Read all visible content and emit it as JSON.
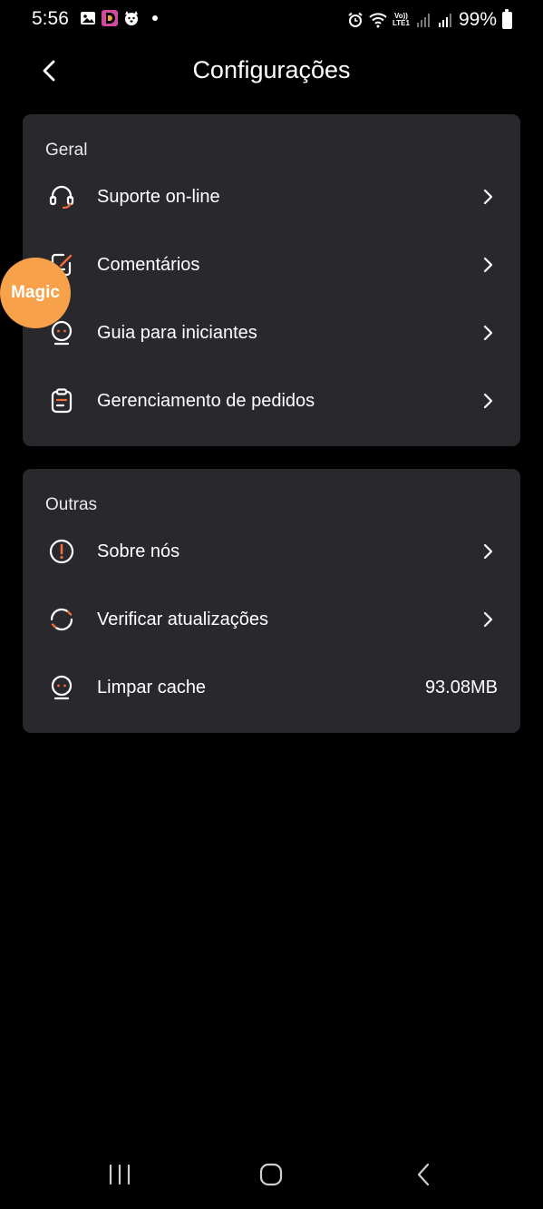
{
  "status_bar": {
    "time": "5:56",
    "battery": "99%",
    "volte_top": "Vo))",
    "volte_bottom": "LTE1",
    "icons": [
      "gallery-icon",
      "app-d-icon",
      "dog-icon",
      "alarm-icon",
      "wifi-icon",
      "volte-icon",
      "signal-icon",
      "signal-icon",
      "battery-icon"
    ]
  },
  "header": {
    "title": "Configurações",
    "back_icon": "chevron-left-icon"
  },
  "sections": {
    "general": {
      "title": "Geral",
      "items": [
        {
          "label": "Suporte on-line",
          "icon": "headset-icon"
        },
        {
          "label": "Comentários",
          "icon": "feedback-edit-icon"
        },
        {
          "label": "Guia para iniciantes",
          "icon": "beginner-guide-icon"
        },
        {
          "label": "Gerenciamento de pedidos",
          "icon": "clipboard-icon"
        }
      ]
    },
    "other": {
      "title": "Outras",
      "items": [
        {
          "label": "Sobre nós",
          "icon": "info-alert-icon"
        },
        {
          "label": "Verificar atualizações",
          "icon": "refresh-icon"
        },
        {
          "label": "Limpar cache",
          "icon": "clean-cache-icon",
          "value": "93.08MB"
        }
      ]
    }
  },
  "magic_bubble": {
    "label": "Magic"
  },
  "colors": {
    "background": "#000000",
    "card": "#29282c",
    "accent": "#f26b3a",
    "bubble": "#f7a14a"
  },
  "nav_bar": {
    "buttons": [
      "recents-icon",
      "home-icon",
      "back-icon"
    ]
  }
}
